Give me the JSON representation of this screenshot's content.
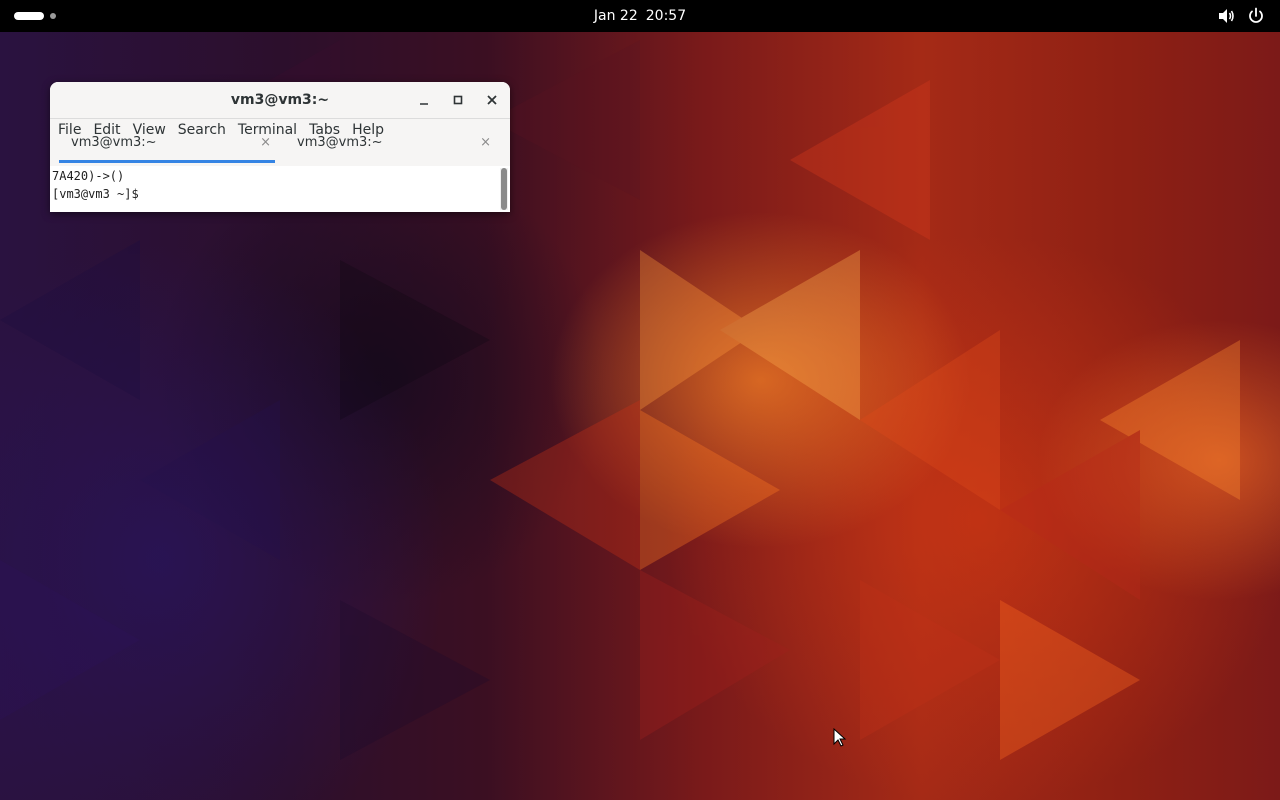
{
  "topbar": {
    "date": "Jan 22",
    "time": "20:57",
    "icons": [
      "workspace-indicator",
      "speaker-icon",
      "power-icon"
    ]
  },
  "window": {
    "title": "vm3@vm3:~",
    "menu": [
      "File",
      "Edit",
      "View",
      "Search",
      "Terminal",
      "Tabs",
      "Help"
    ],
    "tabs": [
      {
        "label": "vm3@vm3:~",
        "active": true
      },
      {
        "label": "vm3@vm3:~",
        "active": false
      }
    ],
    "tab_close_glyph": "×",
    "terminal_lines": [
      "7A420)->()",
      "[vm3@vm3 ~]$ "
    ]
  },
  "colors": {
    "accent": "#3584e4",
    "topbar": "#000000",
    "window_bg": "#f6f5f4"
  }
}
